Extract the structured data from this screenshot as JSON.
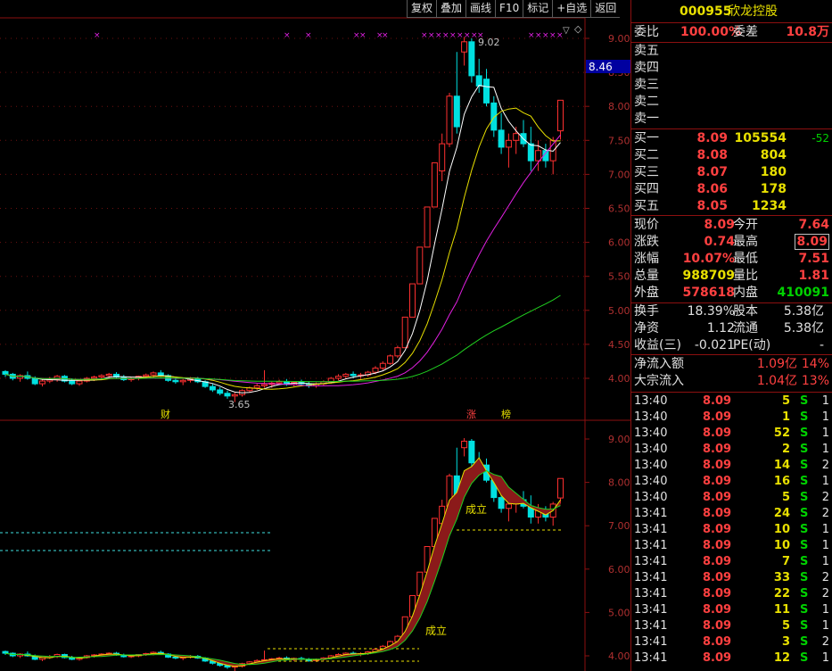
{
  "toolbar": [
    "复权",
    "叠加",
    "画线",
    "F10",
    "标记",
    "+自选",
    "返回"
  ],
  "stock": {
    "code": "000955",
    "name": "欣龙控股"
  },
  "order_book": {
    "wei_bi_label": "委比",
    "wei_bi": "100.00%",
    "wei_cha_label": "委差",
    "wei_cha": "10.8万",
    "sells": [
      {
        "label": "卖五"
      },
      {
        "label": "卖四"
      },
      {
        "label": "卖三"
      },
      {
        "label": "卖二"
      },
      {
        "label": "卖一"
      }
    ],
    "buys": [
      {
        "label": "买一",
        "price": "8.09",
        "vol": "105554",
        "chg": "-52"
      },
      {
        "label": "买二",
        "price": "8.08",
        "vol": "804",
        "chg": ""
      },
      {
        "label": "买三",
        "price": "8.07",
        "vol": "180",
        "chg": ""
      },
      {
        "label": "买四",
        "price": "8.06",
        "vol": "178",
        "chg": ""
      },
      {
        "label": "买五",
        "price": "8.05",
        "vol": "1234",
        "chg": ""
      }
    ]
  },
  "quote": [
    {
      "l1": "现价",
      "v1": "8.09",
      "c1": "red",
      "l2": "今开",
      "v2": "7.64",
      "c2": "red"
    },
    {
      "l1": "涨跌",
      "v1": "0.74",
      "c1": "red",
      "l2": "最高",
      "v2": "8.09",
      "c2": "red"
    },
    {
      "l1": "涨幅",
      "v1": "10.07%",
      "c1": "red",
      "l2": "最低",
      "v2": "7.51",
      "c2": "red"
    },
    {
      "l1": "总量",
      "v1": "988709",
      "c1": "yel",
      "l2": "量比",
      "v2": "1.81",
      "c2": "red"
    },
    {
      "l1": "外盘",
      "v1": "578618",
      "c1": "red",
      "l2": "内盘",
      "v2": "410091",
      "c2": "grn"
    }
  ],
  "fundamentals": [
    {
      "l1": "换手",
      "v1": "18.39%",
      "l2": "股本",
      "v2": "5.38亿"
    },
    {
      "l1": "净资",
      "v1": "1.12",
      "l2": "流通",
      "v2": "5.38亿"
    },
    {
      "l1": "收益(三)",
      "v1": "-0.021",
      "l2": "PE(动)",
      "v2": "-"
    }
  ],
  "flows": [
    {
      "label": "净流入额",
      "value": "1.09亿",
      "pct": "14%"
    },
    {
      "label": "大宗流入",
      "value": "1.04亿",
      "pct": "13%"
    }
  ],
  "ticks": [
    {
      "t": "13:40",
      "p": "8.09",
      "v": "5",
      "s": "S",
      "n": "1"
    },
    {
      "t": "13:40",
      "p": "8.09",
      "v": "1",
      "s": "S",
      "n": "1"
    },
    {
      "t": "13:40",
      "p": "8.09",
      "v": "52",
      "s": "S",
      "n": "1"
    },
    {
      "t": "13:40",
      "p": "8.09",
      "v": "2",
      "s": "S",
      "n": "1"
    },
    {
      "t": "13:40",
      "p": "8.09",
      "v": "14",
      "s": "S",
      "n": "2"
    },
    {
      "t": "13:40",
      "p": "8.09",
      "v": "16",
      "s": "S",
      "n": "1"
    },
    {
      "t": "13:40",
      "p": "8.09",
      "v": "5",
      "s": "S",
      "n": "2"
    },
    {
      "t": "13:41",
      "p": "8.09",
      "v": "24",
      "s": "S",
      "n": "2"
    },
    {
      "t": "13:41",
      "p": "8.09",
      "v": "10",
      "s": "S",
      "n": "1"
    },
    {
      "t": "13:41",
      "p": "8.09",
      "v": "10",
      "s": "S",
      "n": "1"
    },
    {
      "t": "13:41",
      "p": "8.09",
      "v": "7",
      "s": "S",
      "n": "1"
    },
    {
      "t": "13:41",
      "p": "8.09",
      "v": "33",
      "s": "S",
      "n": "2"
    },
    {
      "t": "13:41",
      "p": "8.09",
      "v": "22",
      "s": "S",
      "n": "2"
    },
    {
      "t": "13:41",
      "p": "8.09",
      "v": "11",
      "s": "S",
      "n": "1"
    },
    {
      "t": "13:41",
      "p": "8.09",
      "v": "5",
      "s": "S",
      "n": "1"
    },
    {
      "t": "13:41",
      "p": "8.09",
      "v": "3",
      "s": "S",
      "n": "2"
    },
    {
      "t": "13:41",
      "p": "8.09",
      "v": "12",
      "s": "S",
      "n": "1"
    }
  ],
  "chart_data": [
    {
      "type": "candlestick",
      "ylim": [
        3.6,
        9.3
      ],
      "yticks": [
        "9.00",
        "8.50",
        "8.00",
        "7.50",
        "7.00",
        "6.50",
        "6.00",
        "5.50",
        "5.00",
        "4.50",
        "4.00"
      ],
      "price_tag": "8.46",
      "annotations": {
        "high": "9.02",
        "low": "3.65",
        "markers": [
          "财",
          "涨",
          "榜"
        ]
      },
      "candles": [
        [
          4.1,
          4.12,
          4.02,
          4.06
        ],
        [
          4.06,
          4.08,
          3.97,
          4.0
        ],
        [
          4.0,
          4.06,
          3.95,
          4.04
        ],
        [
          4.04,
          4.1,
          3.98,
          4.0
        ],
        [
          4.0,
          4.03,
          3.9,
          3.92
        ],
        [
          3.92,
          3.98,
          3.88,
          3.96
        ],
        [
          3.96,
          4.02,
          3.93,
          3.98
        ],
        [
          3.98,
          4.05,
          3.95,
          4.03
        ],
        [
          4.03,
          4.05,
          3.94,
          3.96
        ],
        [
          3.96,
          4.0,
          3.9,
          3.92
        ],
        [
          3.92,
          3.98,
          3.89,
          3.96
        ],
        [
          3.96,
          4.02,
          3.94,
          4.0
        ],
        [
          4.0,
          4.04,
          3.96,
          4.02
        ],
        [
          4.02,
          4.06,
          3.98,
          4.04
        ],
        [
          4.04,
          4.08,
          3.99,
          4.06
        ],
        [
          4.06,
          4.09,
          4.0,
          4.02
        ],
        [
          4.02,
          4.05,
          3.96,
          3.98
        ],
        [
          3.98,
          4.02,
          3.95,
          4.0
        ],
        [
          4.0,
          4.04,
          3.97,
          4.03
        ],
        [
          4.03,
          4.07,
          4.0,
          4.05
        ],
        [
          4.05,
          4.1,
          4.01,
          4.08
        ],
        [
          4.08,
          4.12,
          4.02,
          4.04
        ],
        [
          4.04,
          4.06,
          3.95,
          3.97
        ],
        [
          3.97,
          4.0,
          3.92,
          3.95
        ],
        [
          3.95,
          3.99,
          3.9,
          3.97
        ],
        [
          3.97,
          4.02,
          3.94,
          3.99
        ],
        [
          3.99,
          4.02,
          3.93,
          3.95
        ],
        [
          3.95,
          3.97,
          3.86,
          3.88
        ],
        [
          3.88,
          3.92,
          3.8,
          3.83
        ],
        [
          3.83,
          3.87,
          3.75,
          3.78
        ],
        [
          3.78,
          3.82,
          3.7,
          3.74
        ],
        [
          3.74,
          3.79,
          3.65,
          3.76
        ],
        [
          3.76,
          3.84,
          3.73,
          3.82
        ],
        [
          3.82,
          3.88,
          3.79,
          3.86
        ],
        [
          3.86,
          3.92,
          3.83,
          3.89
        ],
        [
          3.89,
          4.12,
          3.86,
          3.91
        ],
        [
          3.91,
          3.95,
          3.86,
          3.93
        ],
        [
          3.93,
          3.98,
          3.9,
          3.95
        ],
        [
          3.95,
          3.99,
          3.89,
          3.91
        ],
        [
          3.91,
          3.96,
          3.88,
          3.94
        ],
        [
          3.94,
          3.98,
          3.9,
          3.92
        ],
        [
          3.92,
          3.95,
          3.86,
          3.89
        ],
        [
          3.89,
          3.94,
          3.86,
          3.92
        ],
        [
          3.92,
          3.97,
          3.89,
          3.95
        ],
        [
          3.95,
          4.02,
          3.92,
          4.0
        ],
        [
          4.0,
          4.06,
          3.97,
          4.03
        ],
        [
          4.03,
          4.08,
          3.99,
          4.06
        ],
        [
          4.06,
          4.1,
          4.0,
          4.04
        ],
        [
          4.04,
          4.08,
          3.99,
          4.05
        ],
        [
          4.05,
          4.11,
          4.02,
          4.09
        ],
        [
          4.09,
          4.18,
          4.06,
          4.15
        ],
        [
          4.15,
          4.25,
          4.12,
          4.22
        ],
        [
          4.22,
          4.35,
          4.2,
          4.33
        ],
        [
          4.33,
          4.48,
          4.3,
          4.45
        ],
        [
          4.45,
          4.9,
          4.45,
          4.9
        ],
        [
          4.9,
          5.39,
          4.9,
          5.39
        ],
        [
          5.39,
          5.93,
          5.39,
          5.93
        ],
        [
          5.93,
          6.52,
          5.93,
          6.52
        ],
        [
          6.52,
          7.17,
          6.52,
          7.17
        ],
        [
          7.05,
          7.6,
          6.9,
          7.45
        ],
        [
          7.45,
          8.2,
          7.4,
          8.15
        ],
        [
          8.15,
          8.8,
          7.6,
          7.7
        ],
        [
          8.8,
          9.02,
          8.6,
          8.95
        ],
        [
          8.95,
          9.0,
          8.35,
          8.45
        ],
        [
          8.45,
          8.7,
          8.2,
          8.3
        ],
        [
          8.4,
          8.55,
          8.0,
          8.05
        ],
        [
          8.05,
          8.15,
          7.55,
          7.65
        ],
        [
          7.65,
          7.9,
          7.3,
          7.4
        ],
        [
          7.4,
          7.6,
          7.1,
          7.5
        ],
        [
          7.5,
          7.7,
          7.3,
          7.6
        ],
        [
          7.6,
          7.8,
          7.4,
          7.45
        ],
        [
          7.45,
          7.7,
          7.05,
          7.2
        ],
        [
          7.2,
          7.5,
          7.05,
          7.35
        ],
        [
          7.35,
          7.45,
          7.1,
          7.2
        ],
        [
          7.2,
          7.55,
          7.0,
          7.5
        ],
        [
          7.64,
          8.09,
          7.51,
          8.09
        ]
      ]
    },
    {
      "type": "candlestick",
      "ylim": [
        3.75,
        9.3
      ],
      "yticks": [
        "9.00",
        "8.00",
        "7.00",
        "6.00",
        "5.00",
        "4.00"
      ],
      "labels": [
        "成立",
        "成立"
      ]
    }
  ]
}
